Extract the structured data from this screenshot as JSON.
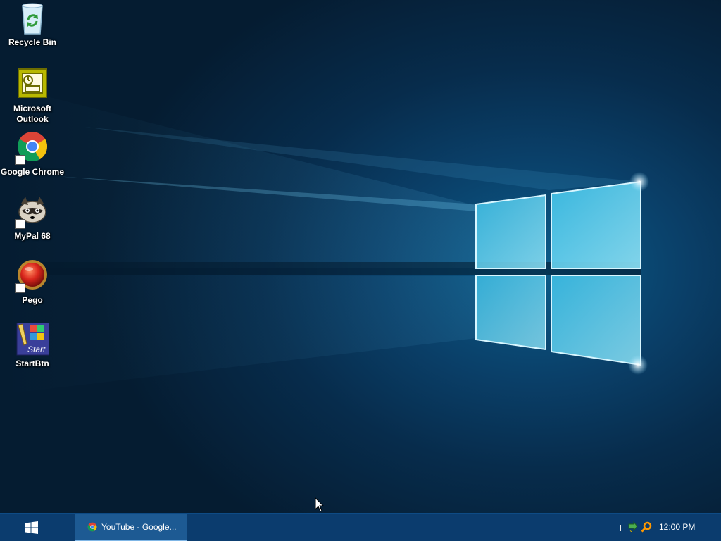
{
  "desktop": {
    "icons": [
      {
        "label": "Recycle Bin",
        "icon": "recycle-bin-icon"
      },
      {
        "label": "Microsoft\nOutlook",
        "icon": "outlook-icon"
      },
      {
        "label": "Google Chrome",
        "icon": "chrome-icon"
      },
      {
        "label": "MyPal 68",
        "icon": "raccoon-icon"
      },
      {
        "label": "Pego",
        "icon": "red-orb-icon"
      },
      {
        "label": "StartBtn",
        "icon": "startbtn-icon",
        "icon_text": "Start"
      }
    ]
  },
  "taskbar": {
    "start_icon": "windows-logo-icon",
    "tasks": [
      {
        "label": "YouTube - Google...",
        "icon": "chrome-icon",
        "active": true
      }
    ],
    "tray": {
      "icons": [
        "tray-separator-icon",
        "green-arrow-icon",
        "orange-magnifier-icon"
      ],
      "clock": "12:00 PM"
    }
  },
  "colors": {
    "taskbar": "#0b3c6e",
    "active_task": "#1d5a93",
    "wallpaper_glow": "#9fe4ff"
  }
}
